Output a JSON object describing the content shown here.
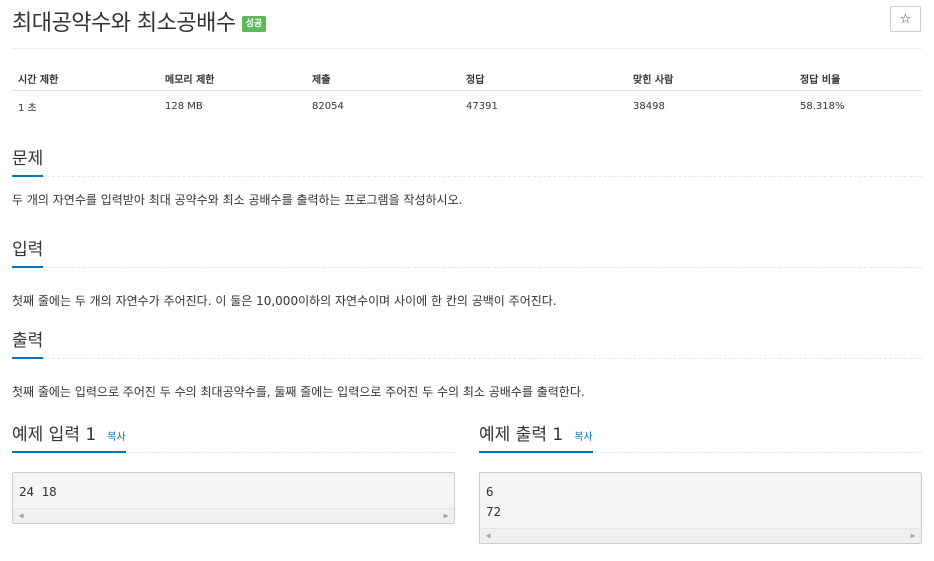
{
  "problem": {
    "title": "최대공약수와 최소공배수",
    "badge": "성공",
    "star_icon": "star-icon",
    "star_glyph": "☆"
  },
  "info_table": {
    "headers": [
      "시간 제한",
      "메모리 제한",
      "제출",
      "정답",
      "맞힌 사람",
      "정답 비율"
    ],
    "values": [
      "1 초",
      "128 MB",
      "82054",
      "47391",
      "38498",
      "58.318%"
    ]
  },
  "sections": {
    "problem_heading": "문제",
    "problem_text": "두 개의 자연수를 입력받아 최대 공약수와 최소 공배수를 출력하는 프로그램을 작성하시오.",
    "input_heading": "입력",
    "input_text": "첫째 줄에는 두 개의 자연수가 주어진다. 이 둘은 10,000이하의 자연수이며 사이에 한 칸의 공백이 주어진다.",
    "output_heading": "출력",
    "output_text": "첫째 줄에는 입력으로 주어진 두 수의 최대공약수를, 둘째 줄에는 입력으로 주어진 두 수의 최소 공배수를 출력한다."
  },
  "samples": {
    "input_title": "예제 입력 1",
    "output_title": "예제 출력 1",
    "copy_label": "복사",
    "input_value": "24 18",
    "output_value": "6\n72"
  },
  "colors": {
    "accent": "#0076c0",
    "success": "#5cb85c"
  }
}
